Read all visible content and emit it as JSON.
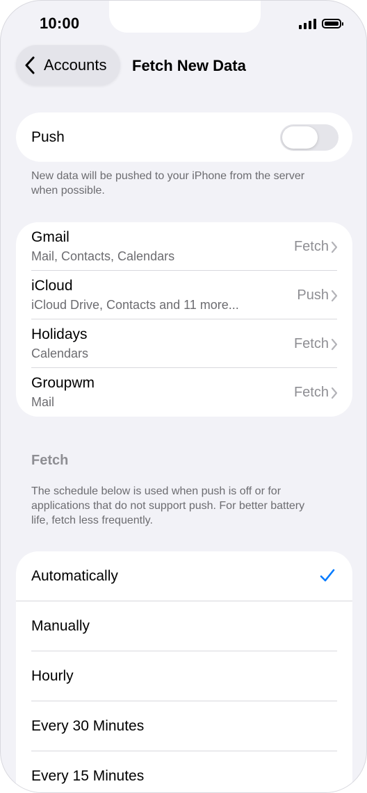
{
  "status_bar": {
    "time": "10:00"
  },
  "nav": {
    "back_label": "Accounts",
    "title": "Fetch New Data"
  },
  "push": {
    "label": "Push",
    "enabled": false,
    "footer": "New data will be pushed to your iPhone from the server when possible."
  },
  "accounts": [
    {
      "name": "Gmail",
      "detail": "Mail, Contacts, Calendars",
      "mode": "Fetch"
    },
    {
      "name": "iCloud",
      "detail": "iCloud Drive, Contacts and 11 more...",
      "mode": "Push"
    },
    {
      "name": "Holidays",
      "detail": "Calendars",
      "mode": "Fetch"
    },
    {
      "name": "Groupwm",
      "detail": "Mail",
      "mode": "Fetch"
    }
  ],
  "fetch": {
    "header": "Fetch",
    "footer": "The schedule below is used when push is off or for applications that do not support push. For better battery life, fetch less frequently.",
    "selected": "Automatically",
    "options": [
      {
        "label": "Automatically"
      },
      {
        "label": "Manually"
      },
      {
        "label": "Hourly"
      },
      {
        "label": "Every 30 Minutes"
      },
      {
        "label": "Every 15 Minutes"
      }
    ]
  },
  "colors": {
    "background": "#f2f2f7",
    "card": "#ffffff",
    "accent": "#007aff",
    "secondary_text": "#6c6c70"
  }
}
